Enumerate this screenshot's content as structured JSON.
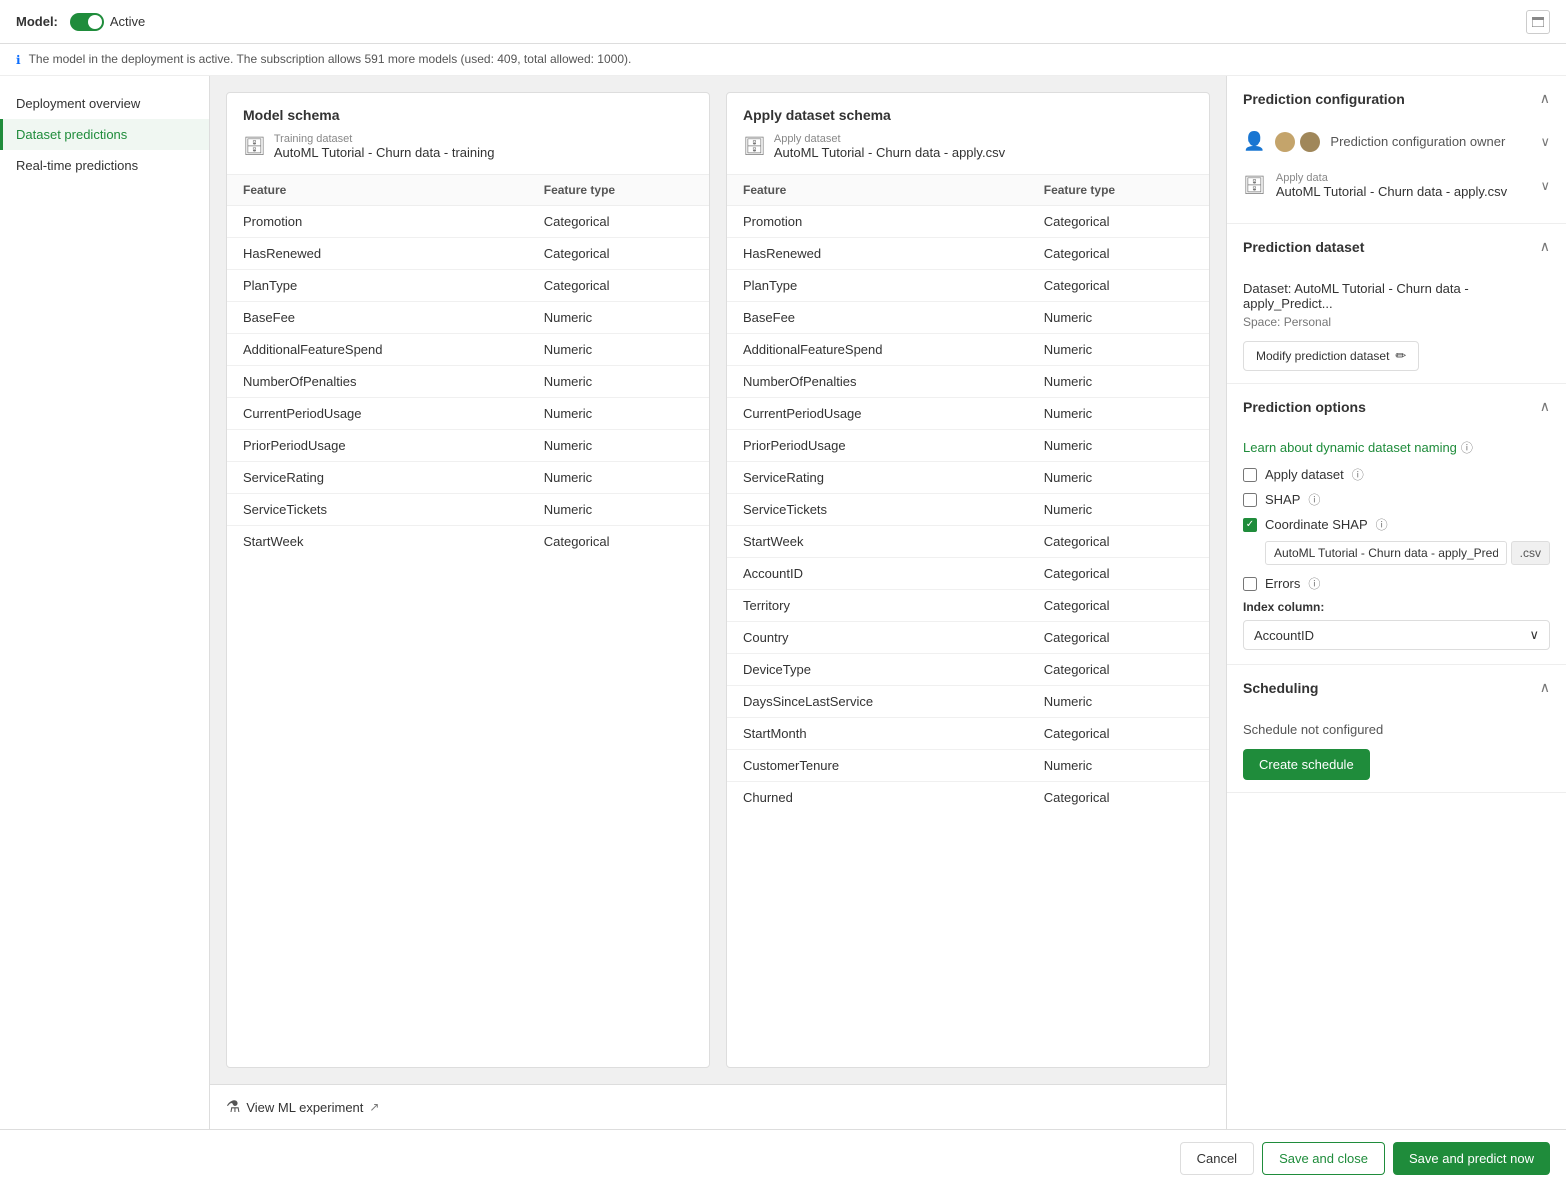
{
  "topbar": {
    "model_label": "Model:",
    "toggle_state": "Active",
    "info_text": "The model in the deployment is active. The subscription allows 591 more models (used: 409, total allowed: 1000)."
  },
  "sidebar": {
    "items": [
      {
        "id": "deployment-overview",
        "label": "Deployment overview",
        "active": false
      },
      {
        "id": "dataset-predictions",
        "label": "Dataset predictions",
        "active": true
      },
      {
        "id": "realtime-predictions",
        "label": "Real-time predictions",
        "active": false
      }
    ]
  },
  "model_schema": {
    "title": "Model schema",
    "dataset_label": "Training dataset",
    "dataset_name": "AutoML Tutorial - Churn data - training",
    "columns": [
      "Feature",
      "Feature type"
    ],
    "rows": [
      [
        "Promotion",
        "Categorical"
      ],
      [
        "HasRenewed",
        "Categorical"
      ],
      [
        "PlanType",
        "Categorical"
      ],
      [
        "BaseFee",
        "Numeric"
      ],
      [
        "AdditionalFeatureSpend",
        "Numeric"
      ],
      [
        "NumberOfPenalties",
        "Numeric"
      ],
      [
        "CurrentPeriodUsage",
        "Numeric"
      ],
      [
        "PriorPeriodUsage",
        "Numeric"
      ],
      [
        "ServiceRating",
        "Numeric"
      ],
      [
        "ServiceTickets",
        "Numeric"
      ],
      [
        "StartWeek",
        "Categorical"
      ]
    ]
  },
  "apply_schema": {
    "title": "Apply dataset schema",
    "dataset_label": "Apply dataset",
    "dataset_name": "AutoML Tutorial - Churn data - apply.csv",
    "columns": [
      "Feature",
      "Feature type"
    ],
    "rows": [
      [
        "Promotion",
        "Categorical"
      ],
      [
        "HasRenewed",
        "Categorical"
      ],
      [
        "PlanType",
        "Categorical"
      ],
      [
        "BaseFee",
        "Numeric"
      ],
      [
        "AdditionalFeatureSpend",
        "Numeric"
      ],
      [
        "NumberOfPenalties",
        "Numeric"
      ],
      [
        "CurrentPeriodUsage",
        "Numeric"
      ],
      [
        "PriorPeriodUsage",
        "Numeric"
      ],
      [
        "ServiceRating",
        "Numeric"
      ],
      [
        "ServiceTickets",
        "Numeric"
      ],
      [
        "StartWeek",
        "Categorical"
      ],
      [
        "AccountID",
        "Categorical"
      ],
      [
        "Territory",
        "Categorical"
      ],
      [
        "Country",
        "Categorical"
      ],
      [
        "DeviceType",
        "Categorical"
      ],
      [
        "DaysSinceLastService",
        "Numeric"
      ],
      [
        "StartMonth",
        "Categorical"
      ],
      [
        "CustomerTenure",
        "Numeric"
      ],
      [
        "Churned",
        "Categorical"
      ]
    ]
  },
  "view_experiment": {
    "label": "View ML experiment",
    "icon": "flask"
  },
  "right_panel": {
    "title": "Prediction configuration",
    "owner_section": {
      "label": "Prediction configuration owner"
    },
    "apply_data_section": {
      "label": "Apply data",
      "value": "AutoML Tutorial - Churn data - apply.csv"
    },
    "prediction_dataset_section": {
      "title": "Prediction dataset",
      "dataset_text": "Dataset: AutoML Tutorial - Churn data - apply_Predict...",
      "space_text": "Space: Personal",
      "modify_label": "Modify prediction dataset"
    },
    "prediction_options_section": {
      "title": "Prediction options",
      "dynamic_link": "Learn about dynamic dataset naming",
      "apply_dataset_label": "Apply dataset",
      "shap_label": "SHAP",
      "coordinate_shap_label": "Coordinate SHAP",
      "shap_input_value": "AutoML Tutorial - Churn data - apply_Predictic",
      "csv_label": ".csv",
      "errors_label": "Errors",
      "index_column_label": "Index column:",
      "index_value": "AccountID"
    },
    "scheduling_section": {
      "title": "Scheduling",
      "status": "Schedule not configured",
      "create_btn": "Create schedule"
    }
  },
  "bottom_bar": {
    "cancel_label": "Cancel",
    "save_close_label": "Save and close",
    "save_predict_label": "Save and predict now"
  }
}
